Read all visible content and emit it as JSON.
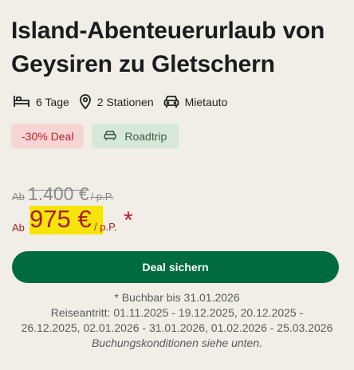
{
  "title": "Island-Abenteuerurlaub von Geysiren zu Gletschern",
  "facts": {
    "duration": "6 Tage",
    "stations": "2 Stationen",
    "car": "Mietauto"
  },
  "badges": {
    "deal": "-30% Deal",
    "type": "Roadtrip"
  },
  "price": {
    "old_prefix": "Ab",
    "old_amount": "1.400 €",
    "old_suffix": "/ p.P.",
    "new_prefix": "Ab",
    "new_amount": "975 €",
    "new_suffix": "/ p.P.",
    "asterisk": "*"
  },
  "cta_label": "Deal sichern",
  "notes": {
    "booking": "* Buchbar bis 31.01.2026",
    "travel_line1": "Reiseantritt: 01.11.2025 - 19.12.2025, 20.12.2025 -",
    "travel_line2": "26.12.2025, 02.01.2026 - 31.01.2026, 01.02.2026 - 25.03.2026",
    "conditions": "Buchungskonditionen siehe unten."
  },
  "colors": {
    "background": "#f1eee7",
    "cta": "#006b3e",
    "price_red": "#a81e1e",
    "highlight": "#f7e40a",
    "deal_badge_bg": "#f8d5d5",
    "roadtrip_badge_bg": "#d5e8d9"
  },
  "icons": [
    "bed-icon",
    "location-pin-icon",
    "car-icon"
  ]
}
